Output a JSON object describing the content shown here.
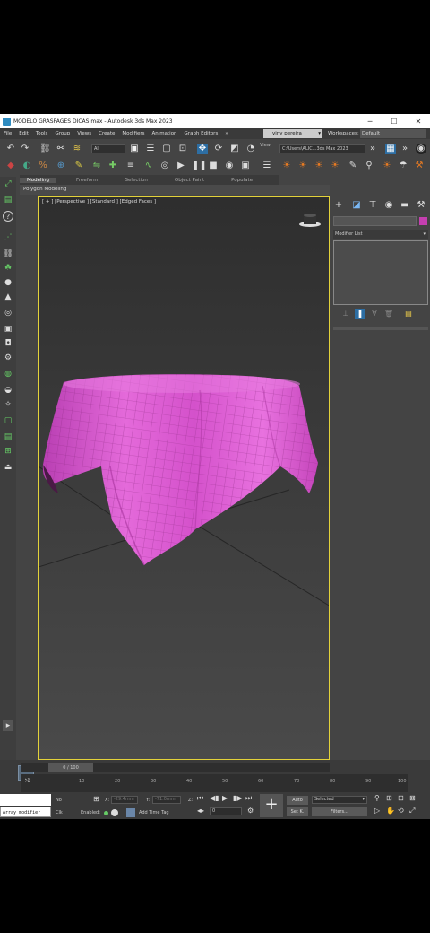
{
  "window": {
    "title": "MODELO GRASPAGES DICAS.max - Autodesk 3ds Max 2023",
    "minimize": "─",
    "maximize": "☐",
    "close": "✕"
  },
  "menu": {
    "items": [
      "File",
      "Edit",
      "Tools",
      "Group",
      "Views",
      "Create",
      "Modifiers",
      "Animation",
      "Graph Editors"
    ],
    "overflow": "»",
    "user": "viny pereira",
    "workspace_label": "Workspaces:",
    "workspace_value": "Default"
  },
  "toolbar": {
    "selection_filter": "All",
    "view_label": "View",
    "path": "C:\\Users\\ALIC...3ds Max 2023"
  },
  "ribbon": {
    "tabs": [
      "Modeling",
      "Freeform",
      "Selection",
      "Object Paint",
      "Populate"
    ],
    "active_tab": "Modeling",
    "sub_label": "Polygon Modeling"
  },
  "viewport": {
    "label": "[ + ] [Perspective ] [Standard ] [Edged Faces ]",
    "cloth_color": "#d957d0"
  },
  "command_panel": {
    "modifier_list": "Modifier List"
  },
  "timeline": {
    "frame_display": "0 / 100",
    "ticks": [
      "10",
      "20",
      "30",
      "40",
      "50",
      "60",
      "70",
      "80",
      "90",
      "100"
    ]
  },
  "status": {
    "script_text": "Array modifier",
    "no_label": "No",
    "clk_label": "Clk",
    "x_label": "X:",
    "y_label": "Y:",
    "z_label": "Z:",
    "x_value": "-29.4mm",
    "y_value": "-71.0mm",
    "enabled_label": "Enabled:",
    "add_time_tag": "Add Time Tag",
    "frame_value": "0",
    "auto_label": "Auto",
    "set_k_label": "Set K.",
    "selected_label": "Selected",
    "filters_label": "Filters..."
  }
}
